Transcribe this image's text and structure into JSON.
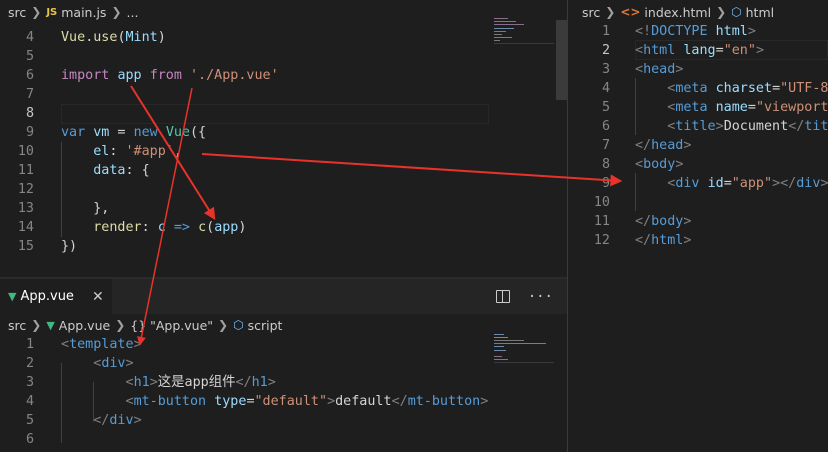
{
  "main_js": {
    "breadcrumb": [
      "src",
      "main.js",
      "..."
    ],
    "lines": [
      {
        "n": "4",
        "segs": [
          [
            "fn",
            "Vue"
          ],
          [
            "tx",
            "."
          ],
          [
            "fn",
            "use"
          ],
          [
            "tx",
            "("
          ],
          [
            "vr",
            "Mint"
          ],
          [
            "tx",
            ")"
          ]
        ]
      },
      {
        "n": "5",
        "segs": []
      },
      {
        "n": "6",
        "segs": [
          [
            "kw",
            "import"
          ],
          [
            "tx",
            " "
          ],
          [
            "vr",
            "app"
          ],
          [
            "tx",
            " "
          ],
          [
            "kw",
            "from"
          ],
          [
            "tx",
            " "
          ],
          [
            "st",
            "'./App.vue'"
          ]
        ]
      },
      {
        "n": "7",
        "segs": []
      },
      {
        "n": "8",
        "segs": []
      },
      {
        "n": "9",
        "segs": [
          [
            "bl",
            "var"
          ],
          [
            "tx",
            " "
          ],
          [
            "vr",
            "vm"
          ],
          [
            "tx",
            " = "
          ],
          [
            "bl",
            "new"
          ],
          [
            "tx",
            " "
          ],
          [
            "ty",
            "Vue"
          ],
          [
            "tx",
            "({"
          ]
        ]
      },
      {
        "n": "10",
        "segs": [
          [
            "tx",
            "    "
          ],
          [
            "vr",
            "el"
          ],
          [
            "tx",
            ": "
          ],
          [
            "st",
            "'#app'"
          ],
          [
            "tx",
            ","
          ]
        ]
      },
      {
        "n": "11",
        "segs": [
          [
            "tx",
            "    "
          ],
          [
            "vr",
            "data"
          ],
          [
            "tx",
            ": {"
          ]
        ]
      },
      {
        "n": "12",
        "segs": []
      },
      {
        "n": "13",
        "segs": [
          [
            "tx",
            "    },"
          ]
        ]
      },
      {
        "n": "14",
        "segs": [
          [
            "tx",
            "    "
          ],
          [
            "fn",
            "render"
          ],
          [
            "tx",
            ": "
          ],
          [
            "vr",
            "c"
          ],
          [
            "tx",
            " "
          ],
          [
            "bl",
            "=>"
          ],
          [
            "tx",
            " "
          ],
          [
            "fn",
            "c"
          ],
          [
            "tx",
            "("
          ],
          [
            "vr",
            "app"
          ],
          [
            "tx",
            ")"
          ]
        ]
      },
      {
        "n": "15",
        "segs": [
          [
            "tx",
            "})"
          ]
        ]
      }
    ]
  },
  "app_vue": {
    "tab_label": "App.vue",
    "close_glyph": "✕",
    "more_glyph": "···",
    "breadcrumb": [
      "src",
      "App.vue",
      "{} \"App.vue\"",
      "script"
    ],
    "lines": [
      {
        "n": "1",
        "segs": [
          [
            "pn",
            "<"
          ],
          [
            "tg",
            "template"
          ],
          [
            "pn",
            ">"
          ]
        ]
      },
      {
        "n": "2",
        "segs": [
          [
            "tx",
            "    "
          ],
          [
            "pn",
            "<"
          ],
          [
            "tg",
            "div"
          ],
          [
            "pn",
            ">"
          ]
        ]
      },
      {
        "n": "3",
        "segs": [
          [
            "tx",
            "        "
          ],
          [
            "pn",
            "<"
          ],
          [
            "tg",
            "h1"
          ],
          [
            "pn",
            ">"
          ],
          [
            "tx",
            "这是app组件"
          ],
          [
            "pn",
            "</"
          ],
          [
            "tg",
            "h1"
          ],
          [
            "pn",
            ">"
          ]
        ]
      },
      {
        "n": "4",
        "segs": [
          [
            "tx",
            "        "
          ],
          [
            "pn",
            "<"
          ],
          [
            "tg",
            "mt-button"
          ],
          [
            "tx",
            " "
          ],
          [
            "at",
            "type"
          ],
          [
            "tx",
            "="
          ],
          [
            "st",
            "\"default\""
          ],
          [
            "pn",
            ">"
          ],
          [
            "tx",
            "default"
          ],
          [
            "pn",
            "</"
          ],
          [
            "tg",
            "mt-button"
          ],
          [
            "pn",
            ">"
          ]
        ]
      },
      {
        "n": "5",
        "segs": [
          [
            "tx",
            "    "
          ],
          [
            "pn",
            "</"
          ],
          [
            "tg",
            "div"
          ],
          [
            "pn",
            ">"
          ]
        ]
      },
      {
        "n": "6",
        "segs": []
      }
    ]
  },
  "index_html": {
    "breadcrumb": [
      "src",
      "index.html",
      "html"
    ],
    "lines": [
      {
        "n": "1",
        "segs": [
          [
            "pn",
            "<!"
          ],
          [
            "tg",
            "DOCTYPE"
          ],
          [
            "tx",
            " "
          ],
          [
            "at",
            "html"
          ],
          [
            "pn",
            ">"
          ]
        ]
      },
      {
        "n": "2",
        "segs": [
          [
            "pn",
            "<"
          ],
          [
            "tg",
            "html"
          ],
          [
            "tx",
            " "
          ],
          [
            "at",
            "lang"
          ],
          [
            "tx",
            "="
          ],
          [
            "st",
            "\"en\""
          ],
          [
            "pn",
            ">"
          ]
        ]
      },
      {
        "n": "3",
        "segs": [
          [
            "pn",
            "<"
          ],
          [
            "tg",
            "head"
          ],
          [
            "pn",
            ">"
          ]
        ]
      },
      {
        "n": "4",
        "segs": [
          [
            "tx",
            "    "
          ],
          [
            "pn",
            "<"
          ],
          [
            "tg",
            "meta"
          ],
          [
            "tx",
            " "
          ],
          [
            "at",
            "charset"
          ],
          [
            "tx",
            "="
          ],
          [
            "st",
            "\"UTF-8\""
          ]
        ]
      },
      {
        "n": "5",
        "segs": [
          [
            "tx",
            "    "
          ],
          [
            "pn",
            "<"
          ],
          [
            "tg",
            "meta"
          ],
          [
            "tx",
            " "
          ],
          [
            "at",
            "name"
          ],
          [
            "tx",
            "="
          ],
          [
            "st",
            "\"viewport\""
          ]
        ]
      },
      {
        "n": "6",
        "segs": [
          [
            "tx",
            "    "
          ],
          [
            "pn",
            "<"
          ],
          [
            "tg",
            "title"
          ],
          [
            "pn",
            ">"
          ],
          [
            "tx",
            "Document"
          ],
          [
            "pn",
            "</"
          ],
          [
            "tg",
            "title"
          ]
        ]
      },
      {
        "n": "7",
        "segs": [
          [
            "pn",
            "</"
          ],
          [
            "tg",
            "head"
          ],
          [
            "pn",
            ">"
          ]
        ]
      },
      {
        "n": "8",
        "segs": [
          [
            "pn",
            "<"
          ],
          [
            "tg",
            "body"
          ],
          [
            "pn",
            ">"
          ]
        ]
      },
      {
        "n": "9",
        "segs": [
          [
            "tx",
            "    "
          ],
          [
            "pn",
            "<"
          ],
          [
            "tg",
            "div"
          ],
          [
            "tx",
            " "
          ],
          [
            "at",
            "id"
          ],
          [
            "tx",
            "="
          ],
          [
            "st",
            "\"app\""
          ],
          [
            "pn",
            "></"
          ],
          [
            "tg",
            "div"
          ],
          [
            "pn",
            ">"
          ]
        ]
      },
      {
        "n": "10",
        "segs": []
      },
      {
        "n": "11",
        "segs": [
          [
            "pn",
            "</"
          ],
          [
            "tg",
            "body"
          ],
          [
            "pn",
            ">"
          ]
        ]
      },
      {
        "n": "12",
        "segs": [
          [
            "pn",
            "</"
          ],
          [
            "tg",
            "html"
          ],
          [
            "pn",
            ">"
          ]
        ]
      }
    ]
  },
  "colors": {
    "arrow": "#e8322a",
    "editor_bg": "#1e1e1e"
  }
}
